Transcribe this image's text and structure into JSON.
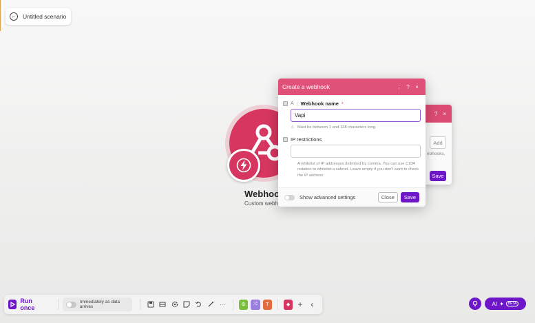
{
  "scenario": {
    "title": "Untitled scenario",
    "back_icon": "arrow-left-circle-icon"
  },
  "module": {
    "title": "Webhoo",
    "subtitle": "Custom webh",
    "color": "#d6365f"
  },
  "back_dialog": {
    "add_label": "Add",
    "text": "ebhooks,",
    "save_label": "Save",
    "help": "?",
    "close": "×"
  },
  "dialog": {
    "title": "Create a webhook",
    "header_buttons": [
      "⋮",
      "?",
      "×"
    ],
    "webhook_name": {
      "type_badge": "A",
      "separator": "|",
      "label": "Webhook name",
      "required_mark": "*",
      "value": "Vapi",
      "hint_icon": "⚠",
      "hint": "Must be between 1 and 128 characters long."
    },
    "ip_restrictions": {
      "label": "IP restrictions",
      "value": "",
      "hint": "A whitelist of IP addresses delimited by comma. You can use CIDR notation to whitelist a subnet. Leave empty if you don't want to check the IP address."
    },
    "footer": {
      "advanced_label": "Show advanced settings",
      "close_label": "Close",
      "save_label": "Save"
    }
  },
  "toolbar": {
    "run_label": "Run once",
    "schedule_label": "Immediately as data arrives",
    "icons": [
      "save-icon",
      "templates-icon",
      "settings-icon",
      "notes-icon",
      "undo-icon",
      "auto-align-icon",
      "more-icon"
    ],
    "colored_tools": [
      {
        "name": "flow-control-tool",
        "color": "#7bbf3f",
        "glyph": "⚙"
      },
      {
        "name": "router-tool",
        "color": "#9b7fe0",
        "glyph": "⤮"
      },
      {
        "name": "text-tool",
        "color": "#e36b3f",
        "glyph": "T"
      },
      {
        "name": "app-tool",
        "color": "#d6365f",
        "glyph": "◆"
      }
    ],
    "add_glyph": "+",
    "collapse_glyph": "‹"
  },
  "ai": {
    "label": "AI",
    "beta": "BETA"
  },
  "colors": {
    "accent": "#6d17c9",
    "header": "#e05179"
  }
}
